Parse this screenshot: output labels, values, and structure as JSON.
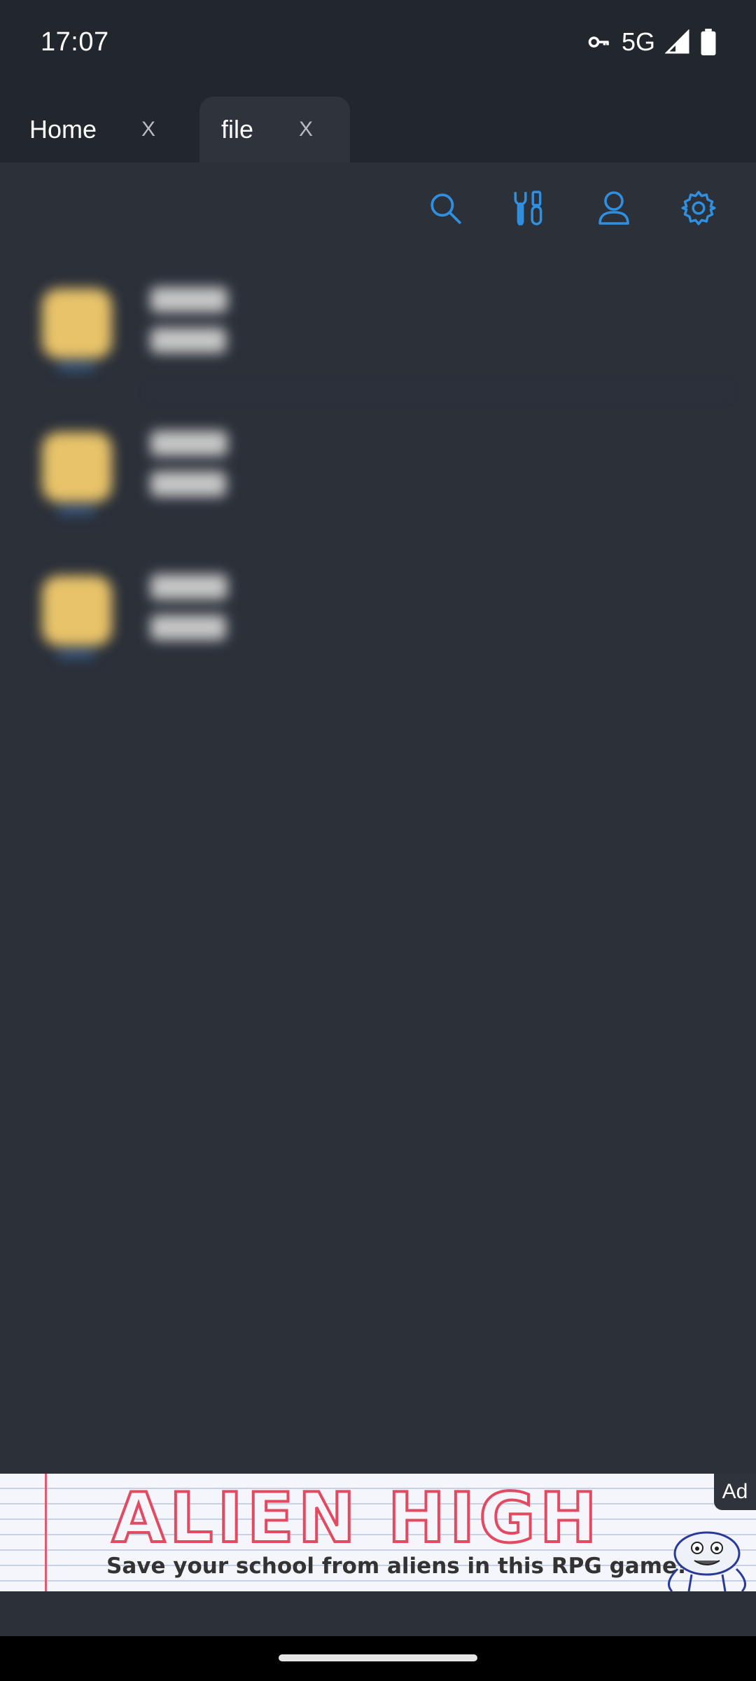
{
  "status_bar": {
    "time": "17:07",
    "network": "5G",
    "icons": [
      "vpn-key-icon",
      "cell-signal-icon",
      "battery-icon"
    ]
  },
  "tabs": [
    {
      "label": "Home",
      "close": "X",
      "active": false
    },
    {
      "label": "file",
      "close": "X",
      "active": true
    }
  ],
  "toolbar": {
    "icons": [
      "search-icon",
      "tools-icon",
      "account-icon",
      "settings-icon"
    ],
    "accent_color": "#2f8fe0"
  },
  "ad": {
    "badge": "Ad",
    "brand": "ALIEN HIGH",
    "tagline": "Save your school from aliens in this RPG game!"
  },
  "colors": {
    "background": "#2b3039",
    "bar": "#22262d",
    "active_tab": "#2e333c",
    "folder": "#e8c36a"
  }
}
